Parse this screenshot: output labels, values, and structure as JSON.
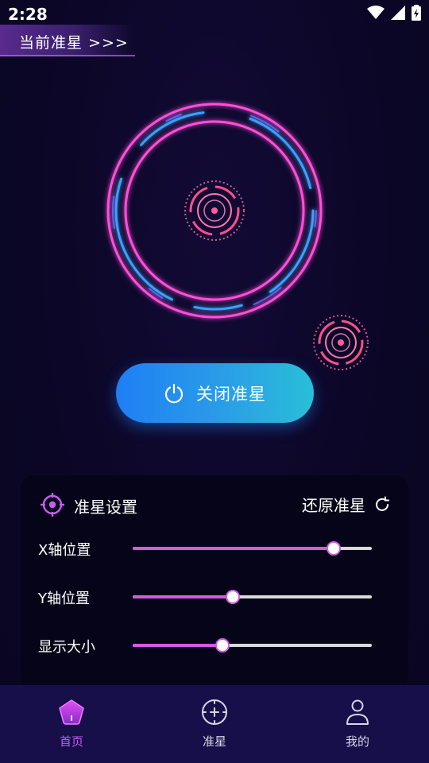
{
  "status_bar": {
    "time": "2:28",
    "icons": [
      "wifi-icon",
      "signal-icon",
      "battery-charging-icon"
    ]
  },
  "banner": {
    "label": "当前准星 >>>"
  },
  "toggle": {
    "label": "关闭准星",
    "icon": "power-icon"
  },
  "settings": {
    "title": "准星设置",
    "title_icon": "crosshair-target-icon",
    "reset_label": "还原准星",
    "reset_icon": "refresh-icon",
    "sliders": [
      {
        "label": "X轴位置",
        "value": 0.84
      },
      {
        "label": "Y轴位置",
        "value": 0.42
      },
      {
        "label": "显示大小",
        "value": 0.375
      }
    ]
  },
  "nav": {
    "items": [
      {
        "label": "首页",
        "icon": "home-pentagon-icon",
        "active": true
      },
      {
        "label": "准星",
        "icon": "crosshair-icon",
        "active": false
      },
      {
        "label": "我的",
        "icon": "user-icon",
        "active": false
      }
    ]
  },
  "colors": {
    "background": "#0b0626",
    "accent": "#d25be4",
    "ring_pink": "#ff4fd8",
    "ring_blue": "#3aa0ff",
    "button_start": "#1e7ff5",
    "button_end": "#29bfd8",
    "nav_bg": "#160f4a"
  }
}
